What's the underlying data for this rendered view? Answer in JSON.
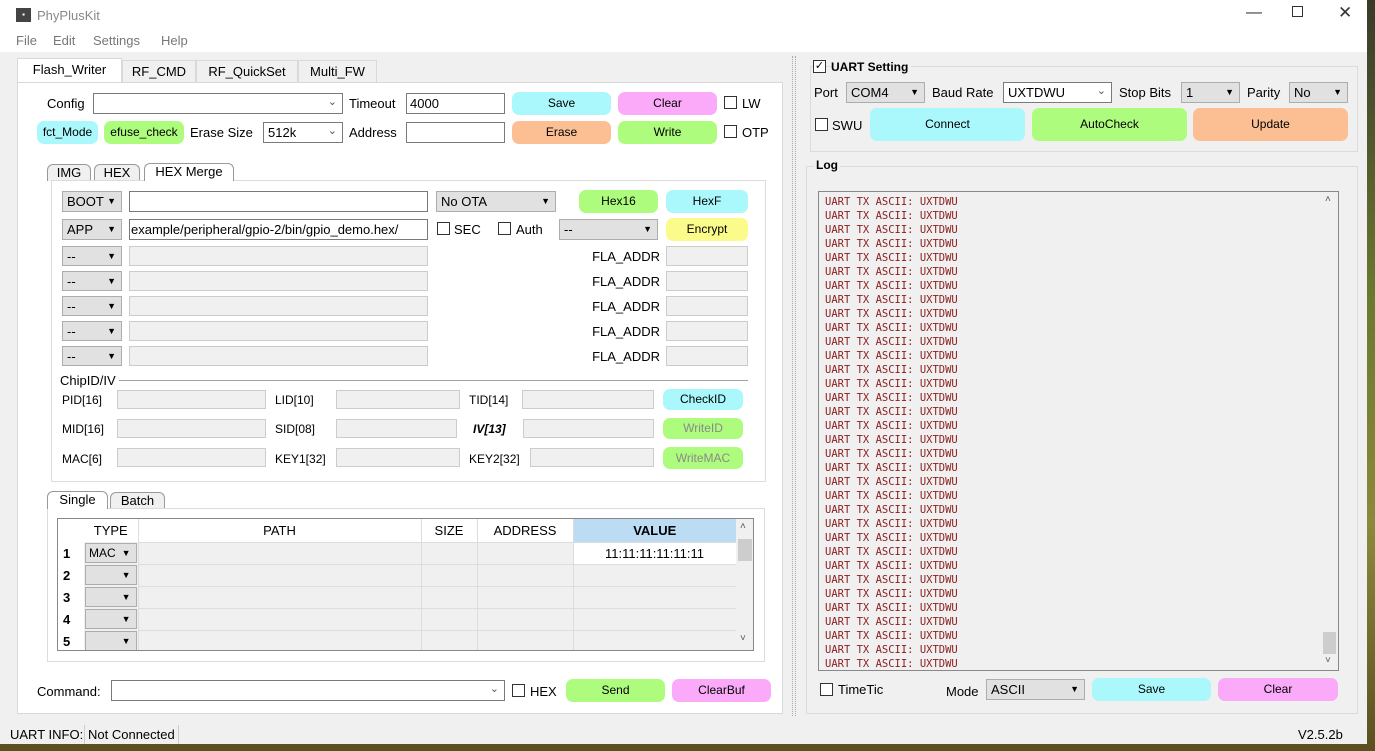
{
  "window": {
    "title": "PhyPlusKit",
    "controls": [
      "minimize",
      "maximize",
      "close"
    ]
  },
  "menu": [
    "File",
    "Edit",
    "Settings",
    "Help"
  ],
  "main_tabs": [
    {
      "label": "Flash_Writer",
      "selected": true
    },
    {
      "label": "RF_CMD"
    },
    {
      "label": "RF_QuickSet"
    },
    {
      "label": "Multi_FW"
    }
  ],
  "flash": {
    "config_label": "Config",
    "config_value": "",
    "timeout_label": "Timeout",
    "timeout_value": "4000",
    "save": "Save",
    "clear": "Clear",
    "lw": "LW",
    "fct_mode": "fct_Mode",
    "efuse_check": "efuse_check",
    "erase_size_label": "Erase Size",
    "erase_size_value": "512k",
    "address_label": "Address",
    "address_value": "",
    "erase": "Erase",
    "write": "Write",
    "otp": "OTP"
  },
  "sub_tabs": [
    {
      "label": "IMG"
    },
    {
      "label": "HEX"
    },
    {
      "label": "HEX Merge",
      "selected": true
    }
  ],
  "merge": {
    "boot_type": "BOOT",
    "boot_path": "",
    "ota": "No OTA",
    "hex16": "Hex16",
    "hexf": "HexF",
    "app_type": "APP",
    "app_path": "/example/peripheral/gpio-2/bin/gpio_demo.hex",
    "sec": "SEC",
    "auth": "Auth",
    "enc_select": "--",
    "encrypt": "Encrypt",
    "extra_rows": [
      {
        "type": "--",
        "label": "FLA_ADDR"
      },
      {
        "type": "--",
        "label": "FLA_ADDR"
      },
      {
        "type": "--",
        "label": "FLA_ADDR"
      },
      {
        "type": "--",
        "label": "FLA_ADDR"
      },
      {
        "type": "--",
        "label": "FLA_ADDR"
      }
    ]
  },
  "chipid": {
    "group": "ChipID/IV",
    "pid": "PID[16]",
    "lid": "LID[10]",
    "tid": "TID[14]",
    "check_id": "CheckID",
    "mid": "MID[16]",
    "sid": "SID[08]",
    "iv": "IV[13]",
    "write_id": "WriteID",
    "mac": "MAC[6]",
    "key1": "KEY1[32]",
    "key2": "KEY2[32]",
    "write_mac": "WriteMAC"
  },
  "batch_tabs": [
    {
      "label": "Single",
      "selected": true
    },
    {
      "label": "Batch"
    }
  ],
  "table": {
    "headers": [
      "TYPE",
      "PATH",
      "SIZE",
      "ADDRESS",
      "VALUE"
    ],
    "rows": [
      {
        "num": "1",
        "type": "MAC",
        "path": "",
        "size": "",
        "address": "",
        "value": "11:11:11:11:11:11"
      },
      {
        "num": "2",
        "type": "",
        "path": "",
        "size": "",
        "address": "",
        "value": ""
      },
      {
        "num": "3",
        "type": "",
        "path": "",
        "size": "",
        "address": "",
        "value": ""
      },
      {
        "num": "4",
        "type": "",
        "path": "",
        "size": "",
        "address": "",
        "value": ""
      },
      {
        "num": "5",
        "type": "",
        "path": "",
        "size": "",
        "address": "",
        "value": ""
      }
    ]
  },
  "command": {
    "label": "Command:",
    "value": "",
    "hex": "HEX",
    "send": "Send",
    "clearbuf": "ClearBuf"
  },
  "uart": {
    "title": "UART Setting",
    "enabled": true,
    "port_label": "Port",
    "port": "COM4",
    "baud_label": "Baud Rate",
    "baud": "UXTDWU",
    "stop_label": "Stop Bits",
    "stop": "1",
    "parity_label": "Parity",
    "parity": "No",
    "swu": "SWU",
    "connect": "Connect",
    "autocheck": "AutoCheck",
    "update": "Update"
  },
  "log": {
    "title": "Log",
    "lines": [
      "UART TX ASCII: UXTDWU",
      "UART TX ASCII: UXTDWU",
      "UART TX ASCII: UXTDWU",
      "UART TX ASCII: UXTDWU",
      "UART TX ASCII: UXTDWU",
      "UART TX ASCII: UXTDWU",
      "UART TX ASCII: UXTDWU",
      "UART TX ASCII: UXTDWU",
      "UART TX ASCII: UXTDWU",
      "UART TX ASCII: UXTDWU",
      "UART TX ASCII: UXTDWU",
      "UART TX ASCII: UXTDWU",
      "UART TX ASCII: UXTDWU",
      "UART TX ASCII: UXTDWU",
      "UART TX ASCII: UXTDWU",
      "UART TX ASCII: UXTDWU",
      "UART TX ASCII: UXTDWU",
      "UART TX ASCII: UXTDWU",
      "UART TX ASCII: UXTDWU",
      "UART TX ASCII: UXTDWU",
      "UART TX ASCII: UXTDWU",
      "UART TX ASCII: UXTDWU",
      "UART TX ASCII: UXTDWU",
      "UART TX ASCII: UXTDWU",
      "UART TX ASCII: UXTDWU",
      "UART TX ASCII: UXTDWU",
      "UART TX ASCII: UXTDWU",
      "UART TX ASCII: UXTDWU",
      "UART TX ASCII: UXTDWU",
      "UART TX ASCII: UXTDWU",
      "UART TX ASCII: UXTDWU",
      "UART TX ASCII: UXTDWU",
      "UART TX ASCII: UXTDWU",
      "UART TX ASCII: UXTDWU"
    ],
    "timetic": "TimeTic",
    "mode_label": "Mode",
    "mode": "ASCII",
    "save": "Save",
    "clear": "Clear"
  },
  "status": {
    "label": "UART INFO:",
    "value": "Not Connected",
    "version": "V2.5.2b"
  },
  "colors": {
    "cyan": "#aaf8fb",
    "pink": "#faaaf9",
    "green": "#adfc7d",
    "orange": "#fbbf93",
    "yellow": "#fbfb8b",
    "log_text": "#8b1d1d",
    "value_header": "#bcdcf4"
  }
}
